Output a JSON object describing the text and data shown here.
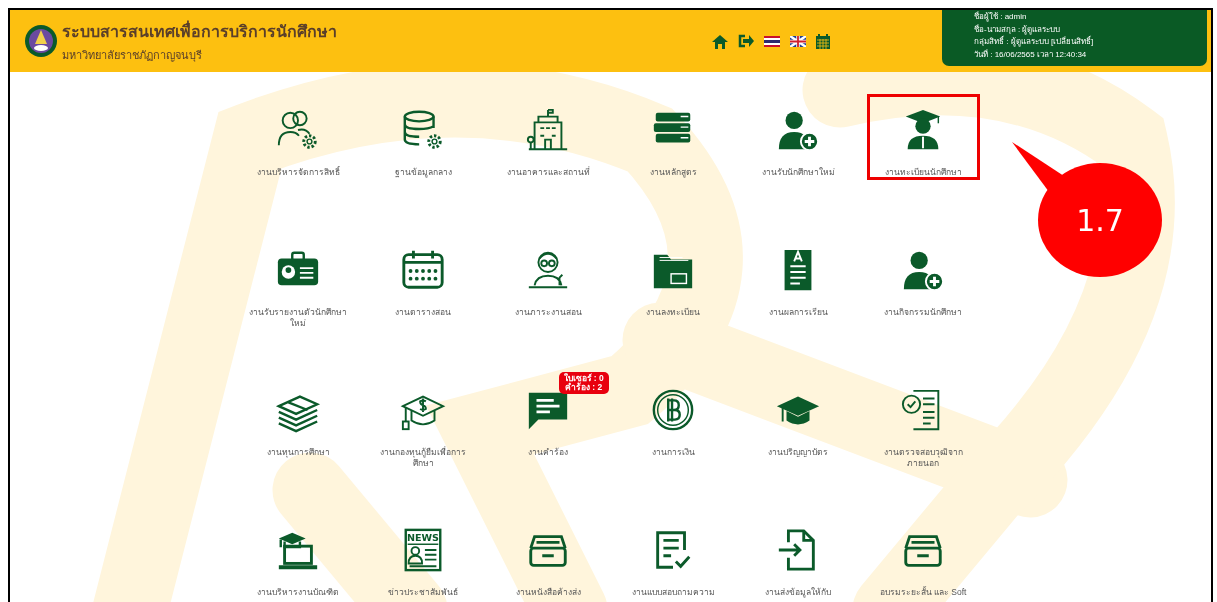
{
  "header": {
    "title": "ระบบสารสนเทศเพื่อการบริการนักศึกษา",
    "subtitle": "มหาวิทยาลัยราชภัฏกาญจนบุรี",
    "user_info": [
      {
        "text": "ชื่อผู้ใช้ : admin"
      },
      {
        "text": "ชื่อ-นามสกุล : ผู้ดูแลระบบ"
      },
      {
        "text": "กลุ่มสิทธิ์ : ผู้ดูแลระบบ ",
        "link": "[เปลี่ยนสิทธิ์]"
      },
      {
        "text": "วันที่ : 16/06/2565 เวลา 12:40:34"
      }
    ]
  },
  "menu": [
    {
      "label": "งานบริหารจัดการสิทธิ์",
      "selected": false
    },
    {
      "label": "ฐานข้อมูลกลาง",
      "selected": false
    },
    {
      "label": "งานอาคารและสถานที่",
      "selected": false
    },
    {
      "label": "งานหลักสูตร",
      "selected": false
    },
    {
      "label": "งานรับนักศึกษาใหม่",
      "selected": false
    },
    {
      "label": "งานทะเบียนนักศึกษา",
      "selected": true
    },
    {
      "label": "งานรับรายงานตัวนักศึกษาใหม่",
      "selected": false
    },
    {
      "label": "งานตารางสอน",
      "selected": false
    },
    {
      "label": "งานภาระงานสอน",
      "selected": false
    },
    {
      "label": "งานลงทะเบียน",
      "selected": false
    },
    {
      "label": "งานผลการเรียน",
      "selected": false
    },
    {
      "label": "งานกิจกรรมนักศึกษา",
      "selected": false
    },
    {
      "label": "งานทุนการศึกษา",
      "selected": false
    },
    {
      "label": "งานกองทุนกู้ยืมเพื่อการศึกษา",
      "selected": false
    },
    {
      "label": "งานคำร้อง",
      "selected": false,
      "badge": [
        "ใบเซอร์ : 0",
        "คำร้อง : 2"
      ]
    },
    {
      "label": "งานการเงิน",
      "selected": false
    },
    {
      "label": "งานปริญญาบัตร",
      "selected": false
    },
    {
      "label": "งานตรวจสอบวุฒิจากภายนอก",
      "selected": false
    },
    {
      "label": "งานบริหารงานบัณฑิต",
      "selected": false
    },
    {
      "label": "ข่าวประชาสัมพันธ์",
      "selected": false,
      "icon_text": "NEWS"
    },
    {
      "label": "งานหนังสือค้างส่ง",
      "selected": false
    },
    {
      "label": "งานแบบสอบถามความ",
      "selected": false
    },
    {
      "label": "งานส่งข้อมูลให้กับ",
      "selected": false
    },
    {
      "label": "อบรมระยะสั้น และ Soft",
      "selected": false
    }
  ],
  "callout": {
    "text": "1.7"
  }
}
